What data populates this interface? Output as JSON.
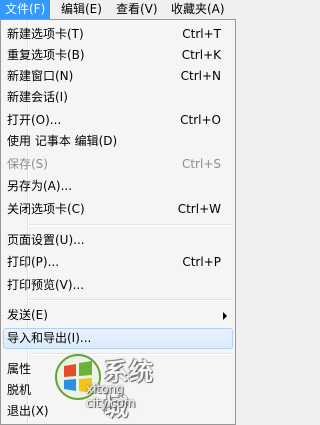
{
  "menubar": {
    "items": [
      {
        "label": "文件(F)"
      },
      {
        "label": "编辑(E)"
      },
      {
        "label": "查看(V)"
      },
      {
        "label": "收藏夹(A)"
      }
    ]
  },
  "menu": {
    "items": [
      {
        "label": "新建选项卡(T)",
        "shortcut": "Ctrl+T"
      },
      {
        "label": "重复选项卡(B)",
        "shortcut": "Ctrl+K"
      },
      {
        "label": "新建窗口(N)",
        "shortcut": "Ctrl+N"
      },
      {
        "label": "新建会话(I)",
        "shortcut": ""
      },
      {
        "label": "打开(O)...",
        "shortcut": "Ctrl+O"
      },
      {
        "label": "使用 记事本 编辑(D)",
        "shortcut": ""
      },
      {
        "label": "保存(S)",
        "shortcut": "Ctrl+S"
      },
      {
        "label": "另存为(A)...",
        "shortcut": ""
      },
      {
        "label": "关闭选项卡(C)",
        "shortcut": "Ctrl+W"
      },
      {
        "label": "页面设置(U)...",
        "shortcut": ""
      },
      {
        "label": "打印(P)...",
        "shortcut": "Ctrl+P"
      },
      {
        "label": "打印预览(V)...",
        "shortcut": ""
      },
      {
        "label": "发送(E)",
        "shortcut": ""
      },
      {
        "label": "导入和导出(I)...",
        "shortcut": ""
      },
      {
        "label": "属性",
        "shortcut": ""
      },
      {
        "label": "脱机",
        "shortcut": ""
      },
      {
        "label": "退出(X)",
        "shortcut": ""
      }
    ]
  },
  "watermark": {
    "text": "系统城",
    "url": "xitong city.com"
  },
  "colors": {
    "menubar_active": "#3399ff",
    "hover_border": "#aecff7",
    "disabled_text": "#8d8d8d"
  }
}
